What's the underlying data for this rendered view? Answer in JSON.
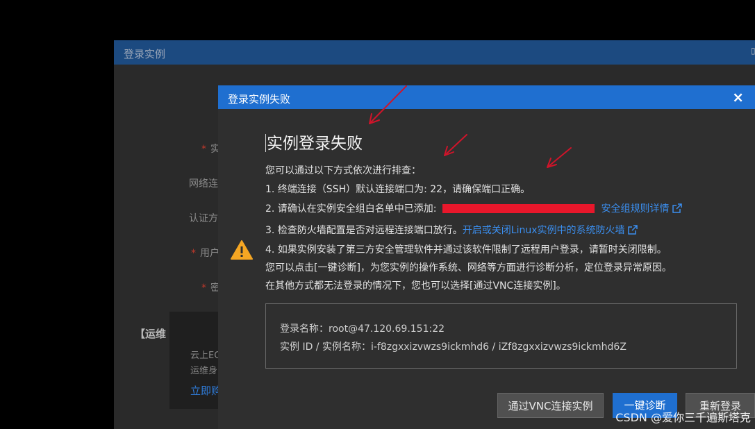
{
  "background_window": {
    "title": "登录实例",
    "fields": [
      "实",
      "网络连",
      "认证方",
      "用户",
      "密"
    ],
    "card_title": "【运维",
    "card_line1": "云上EC",
    "card_line2": "运维身",
    "card_link": "立即购"
  },
  "dialog": {
    "title": "登录实例失败",
    "close_glyph": "×",
    "heading": "实例登录失败",
    "intro": "您可以通过以下方式依次进行排查：",
    "step1": "1. 终端连接（SSH）默认连接端口为: 22，请确保端口正确。",
    "step2": "2. 请确认在实例安全组白名单中已添加:",
    "step2_link": "安全组规则详情",
    "step3": "3. 检查防火墙配置是否对远程连接端口放行。",
    "step3_link": "开启或关闭Linux实例中的系统防火墙",
    "step4": "4. 如果实例安装了第三方安全管理软件并通过该软件限制了远程用户登录，请暂时关闭限制。",
    "line5": "您可以点击[一键诊断]，为您实例的操作系统、网络等方面进行诊断分析，定位登录异常原因。",
    "line6": "在其他方式都无法登录的情况下，您也可以选择[通过VNC连接实例]。",
    "info_login": "登录名称：root@47.120.69.151:22",
    "info_instance": "实例 ID / 实例名称：i-f8zgxxizvwzs9ickmhd6 / iZf8zgxxizvwzs9ickmhd6Z",
    "buttons": {
      "vnc": "通过VNC连接实例",
      "diagnose": "一键诊断",
      "relogin": "重新登录"
    }
  },
  "watermark": "CSDN @爱你三千遍斯塔克",
  "colors": {
    "accent": "#1f6fd0",
    "link": "#3b8ff0",
    "warning": "#f5a623",
    "redacted": "#e8172b",
    "annotation_arrow": "#d0142a"
  },
  "icons": [
    "warning-icon",
    "external-link-icon",
    "close-icon"
  ]
}
